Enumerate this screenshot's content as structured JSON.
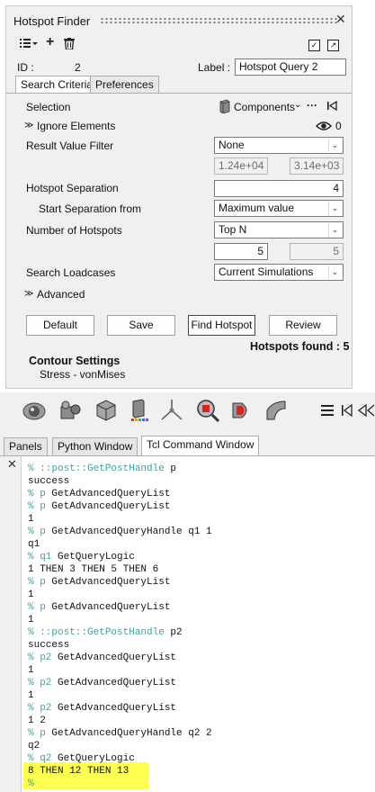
{
  "panel": {
    "title": "Hotspot Finder",
    "id_label": "ID :",
    "id_value": "2",
    "label_label": "Label :",
    "label_value": "Hotspot Query 2",
    "tabs": [
      {
        "label": "Search Criteria",
        "active": true
      },
      {
        "label": "Preferences",
        "active": false
      }
    ],
    "selection_label": "Selection",
    "components_label": "Components",
    "ellipsis": "···",
    "ignore_elements_label": "Ignore Elements",
    "ignore_count": "0",
    "result_value_filter_label": "Result Value Filter",
    "result_value_filter_value": "None",
    "filter_min": "1.24e+04",
    "filter_max": "3.14e+03",
    "hotspot_separation_label": "Hotspot Separation",
    "hotspot_separation_value": "4",
    "start_separation_label": "Start Separation from",
    "start_separation_value": "Maximum value",
    "num_hotspots_label": "Number of Hotspots",
    "num_hotspots_value": "Top N",
    "num_hotspots_n": "5",
    "num_hotspots_n2": "5",
    "search_loadcases_label": "Search Loadcases",
    "search_loadcases_value": "Current Simulations",
    "advanced_label": "Advanced",
    "buttons": {
      "default": "Default",
      "save": "Save",
      "find": "Find Hotspot",
      "review": "Review"
    },
    "hotspots_found": "Hotspots found : 5",
    "contour_title": "Contour Settings",
    "contour_value": "Stress - vonMises"
  },
  "bottom_tabs": [
    {
      "label": "Panels",
      "active": false
    },
    {
      "label": "Python Window",
      "active": false
    },
    {
      "label": "Tcl Command Window",
      "active": true
    }
  ],
  "console_lines": [
    {
      "prompt": "% ",
      "cmd": "::post::GetPostHandle p",
      "out": false
    },
    {
      "text": "success",
      "out": true
    },
    {
      "prompt": "% ",
      "cmd": "p GetAdvancedQueryList",
      "out": false
    },
    {
      "prompt": "% ",
      "cmd": "p GetAdvancedQueryList",
      "out": false
    },
    {
      "text": "1",
      "out": true
    },
    {
      "prompt": "% ",
      "cmd": "p GetAdvancedQueryHandle q1 1",
      "out": false
    },
    {
      "text": "q1",
      "out": true
    },
    {
      "prompt": "% ",
      "cmd": "q1 GetQueryLogic",
      "out": false
    },
    {
      "text": "1 THEN 3 THEN 5 THEN 6",
      "out": true
    },
    {
      "prompt": "% ",
      "cmd": "p GetAdvancedQueryList",
      "out": false
    },
    {
      "text": "1",
      "out": true
    },
    {
      "prompt": "% ",
      "cmd": "p GetAdvancedQueryList",
      "out": false
    },
    {
      "text": "1",
      "out": true
    },
    {
      "prompt": "% ",
      "cmd": "::post::GetPostHandle p2",
      "out": false
    },
    {
      "text": "success",
      "out": true
    },
    {
      "prompt": "% ",
      "cmd": "p2 GetAdvancedQueryList",
      "out": false
    },
    {
      "text": "1",
      "out": true
    },
    {
      "prompt": "% ",
      "cmd": "p2 GetAdvancedQueryList",
      "out": false
    },
    {
      "text": "1",
      "out": true
    },
    {
      "prompt": "% ",
      "cmd": "p2 GetAdvancedQueryList",
      "out": false
    },
    {
      "text": "1 2",
      "out": true
    },
    {
      "prompt": "% ",
      "cmd": "p GetAdvancedQueryHandle q2 2",
      "out": false
    },
    {
      "text": "q2",
      "out": true
    },
    {
      "prompt": "% ",
      "cmd": "q2 GetQueryLogic",
      "out": false
    },
    {
      "text": "8 THEN 12 THEN 13",
      "out": true
    },
    {
      "prompt": "%",
      "cmd": "",
      "out": false
    }
  ],
  "colors": {
    "prompt": "#3aa3a3",
    "highlight": "#ffff4f"
  }
}
